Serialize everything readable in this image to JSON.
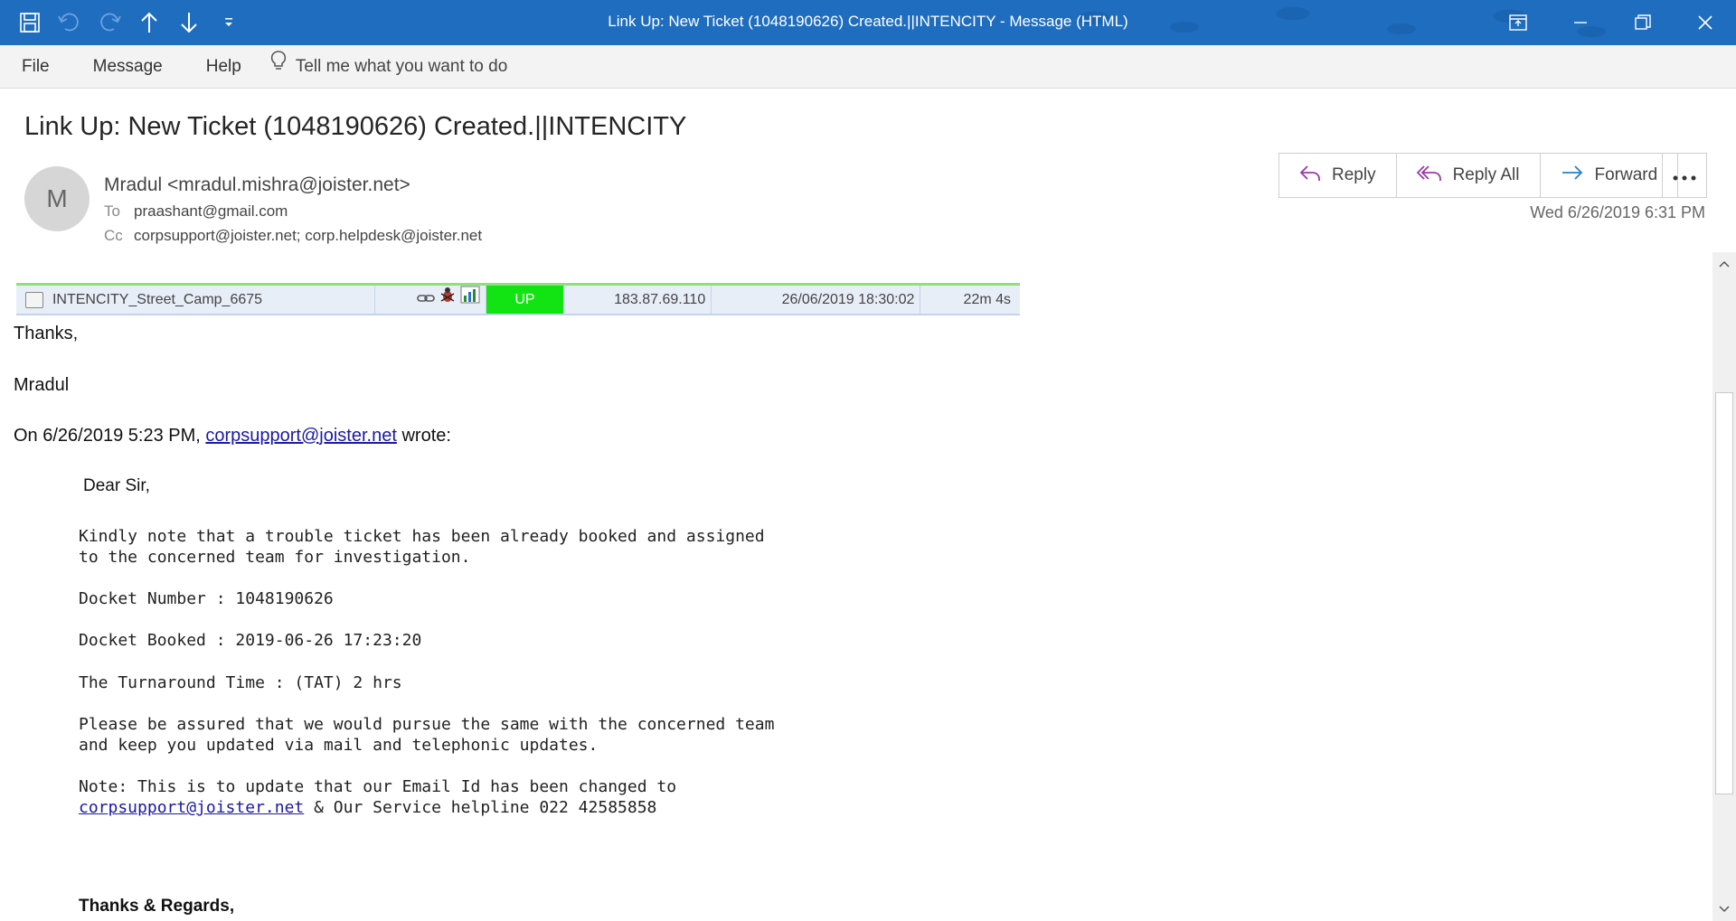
{
  "window": {
    "title": "Link Up: New Ticket (1048190626) Created.||INTENCITY  -  Message (HTML)"
  },
  "quick_access": [
    "save-icon",
    "undo-icon",
    "redo-icon",
    "arrow-up-icon",
    "arrow-down-icon",
    "customize-icon"
  ],
  "menu": {
    "file": "File",
    "message": "Message",
    "help": "Help",
    "tell_me": "Tell me what you want to do"
  },
  "header": {
    "subject": "Link Up: New Ticket (1048190626) Created.||INTENCITY",
    "avatar_letter": "M",
    "sender": "Mradul <mradul.mishra@joister.net>",
    "to_label": "To",
    "to": "praashant@gmail.com",
    "cc_label": "Cc",
    "cc": "corpsupport@joister.net; corp.helpdesk@joister.net",
    "date": "Wed 6/26/2019 6:31 PM"
  },
  "actions": {
    "reply": "Reply",
    "reply_all": "Reply All",
    "forward": "Forward"
  },
  "status_row": {
    "name": "INTENCITY_Street_Camp_6675",
    "status": "UP",
    "ip": "183.87.69.110",
    "timestamp": "26/06/2019 18:30:02",
    "duration": "22m 4s",
    "status_color": "#12e312"
  },
  "body": {
    "thanks": "Thanks,",
    "signature": "Mradul",
    "quote_prefix": "On 6/26/2019 5:23 PM,",
    "quote_email": "corpsupport@joister.net",
    "quote_suffix": "wrote:",
    "greeting": "Dear Sir,",
    "para1_line1": "Kindly note that a trouble ticket has been already booked and assigned",
    "para1_line2": "to the concerned team for investigation.",
    "docket_number": "Docket Number : 1048190626",
    "docket_booked": "Docket Booked : 2019-06-26 17:23:20",
    "tat": "The Turnaround Time : (TAT) 2 hrs",
    "para2_line1": "Please be assured that we would pursue the same with the concerned team",
    "para2_line2": "and keep you updated via mail and telephonic updates.",
    "note_line1": "Note: This is to update that our Email Id has been changed to",
    "note_email": "corpsupport@joister.net",
    "note_line2_rest": " & Our Service helpline 022 42585858",
    "regards": "Thanks & Regards,"
  }
}
